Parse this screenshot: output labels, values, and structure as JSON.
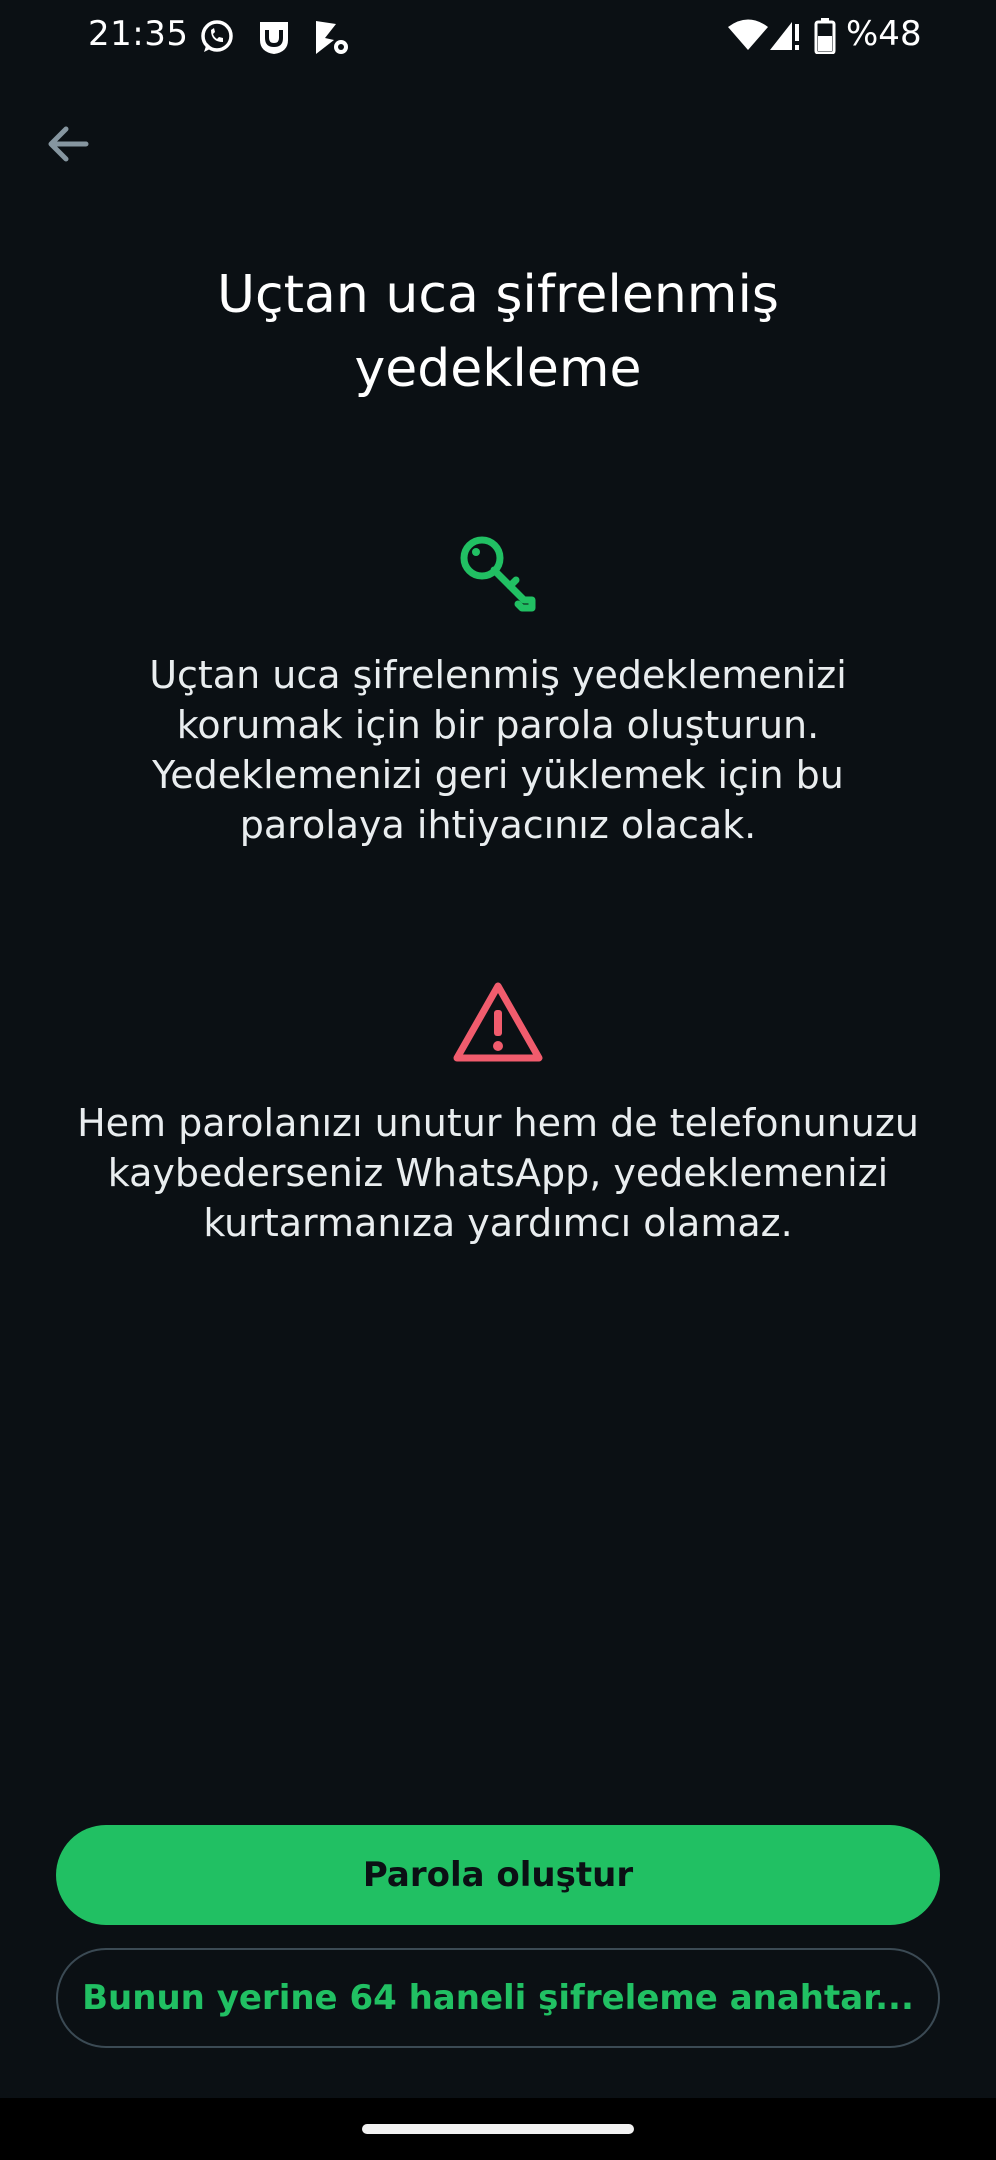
{
  "status_bar": {
    "time": "21:35",
    "battery_percent": "%48",
    "icons": [
      "whatsapp-icon",
      "notification-app-icon",
      "media-app-icon",
      "wifi-icon",
      "signal-icon",
      "battery-icon"
    ]
  },
  "header": {
    "back_icon": "arrow-left-icon"
  },
  "title": "Uçtan uca şifrelenmiş\nyedekleme",
  "info": {
    "icon": "key-icon",
    "text": "Uçtan uca şifrelenmiş yedeklemenizi korumak için bir parola oluşturun. Yedeklemenizi geri yüklemek için bu parolaya ihtiyacınız olacak."
  },
  "warning": {
    "icon": "warning-triangle-icon",
    "text": "Hem parolanızı unutur hem de telefonunuzu kaybederseniz WhatsApp, yedeklemenizi kurtarmanıza yardımcı olamaz."
  },
  "buttons": {
    "primary_label": "Parola oluştur",
    "secondary_label": "Bunun yerine 64 haneli şifreleme anahtar..."
  },
  "colors": {
    "background": "#0b1014",
    "accent_green": "#21c063",
    "warning_red": "#f15c6d",
    "text": "#e9edef"
  }
}
